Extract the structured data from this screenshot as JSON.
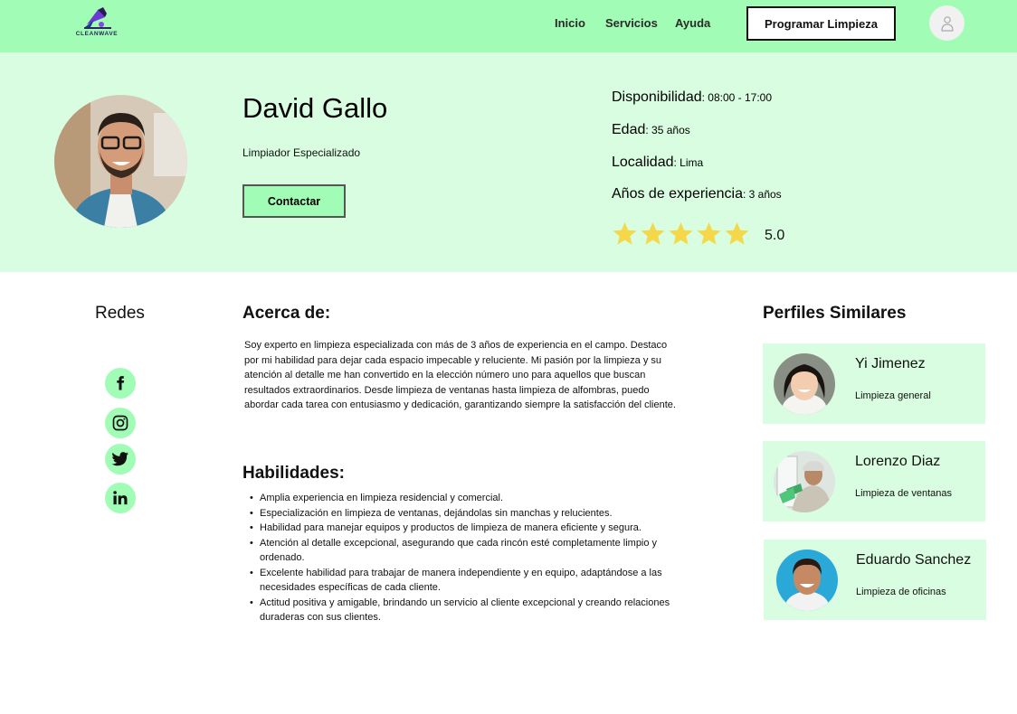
{
  "header": {
    "brand": "CLEANWAVE",
    "nav": [
      "Inicio",
      "Servicios",
      "Ayuda"
    ],
    "cta_label": "Programar Limpieza"
  },
  "profile": {
    "name": "David Gallo",
    "role": "Limpiador Especializado",
    "contact_label": "Contactar",
    "info": [
      {
        "label": "Disponibilidad",
        "value": ": 08:00 - 17:00"
      },
      {
        "label": "Edad",
        "value": ": 35 años"
      },
      {
        "label": "Localidad",
        "value": ": Lima"
      },
      {
        "label": "Años de experiencia",
        "value": ": 3 años"
      }
    ],
    "rating": "5.0",
    "stars": 5,
    "star_color": "#f4d84a"
  },
  "redes": {
    "title": "Redes",
    "icons": [
      "facebook-icon",
      "instagram-icon",
      "twitter-icon",
      "linkedin-icon"
    ]
  },
  "about": {
    "title": "Acerca de:",
    "text": "Soy experto en limpieza especializada con más de 3 años de experiencia en el campo. Destaco por mi habilidad para dejar cada espacio impecable y reluciente. Mi pasión por la limpieza y su atención al detalle me han convertido en la elección número uno para aquellos que buscan resultados extraordinarios. Desde limpieza de ventanas hasta limpieza de alfombras, puedo abordar cada tarea con entusiasmo y dedicación, garantizando siempre la satisfacción del cliente."
  },
  "skills": {
    "title": "Habilidades:",
    "items": [
      "Amplia experiencia en limpieza residencial y comercial.",
      "Especialización en limpieza de ventanas, dejándolas sin manchas y relucientes.",
      "Habilidad para manejar equipos y productos de limpieza de manera eficiente y segura.",
      "Atención al detalle excepcional, asegurando que cada rincón esté completamente limpio y ordenado.",
      "Excelente habilidad para trabajar de manera independiente y en equipo, adaptándose a las necesidades específicas de cada cliente.",
      "Actitud positiva y amigable, brindando un servicio al cliente excepcional y creando relaciones duraderas con sus clientes."
    ]
  },
  "similar": {
    "title": "Perfiles Similares",
    "profiles": [
      {
        "name": "Yi Jimenez",
        "job": "Limpieza general"
      },
      {
        "name": "Lorenzo Diaz",
        "job": "Limpieza de ventanas"
      },
      {
        "name": "Eduardo Sanchez",
        "job": "Limpieza de oficinas"
      }
    ]
  },
  "colors": {
    "accent_green": "#a1fcb5",
    "light_green": "#d9fde0"
  }
}
